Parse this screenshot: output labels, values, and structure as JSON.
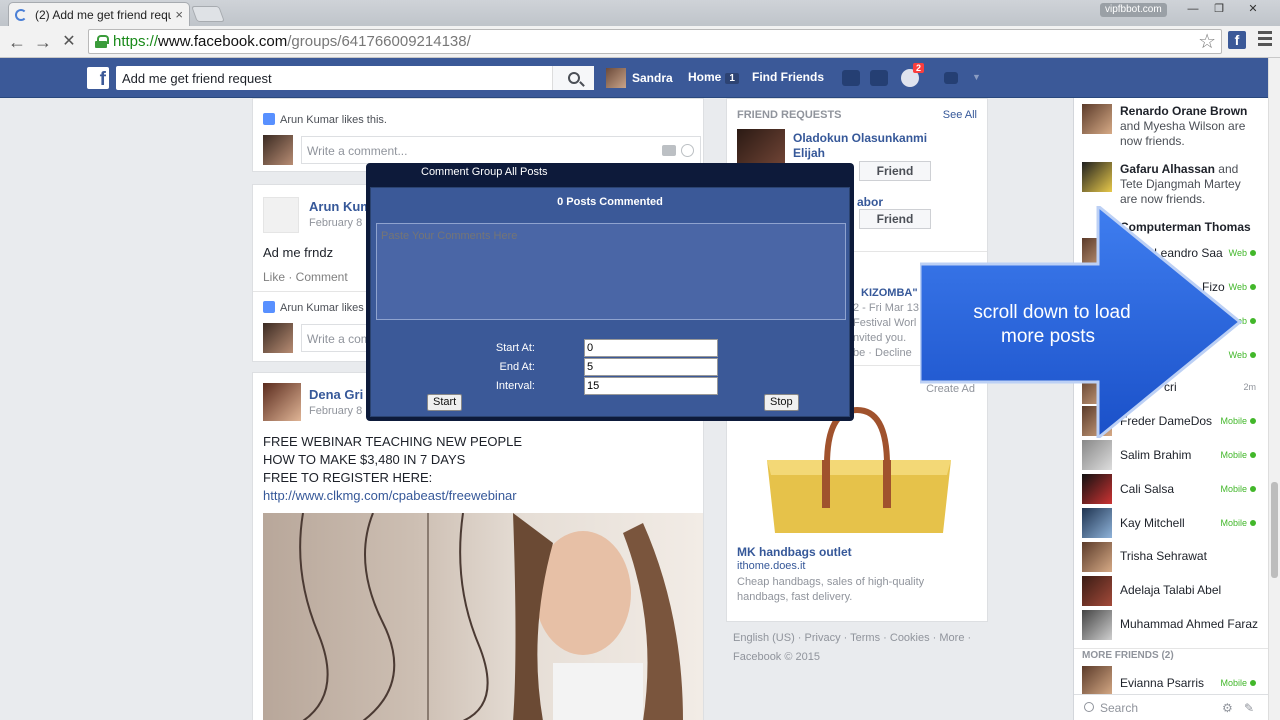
{
  "browser": {
    "tab_title": "(2) Add me get friend requ",
    "tab_close": "×",
    "window_label": "vipfbbot.com",
    "url_scheme": "https://",
    "url_host": "www.facebook.com",
    "url_path": "/groups/641766009214138/",
    "controls": {
      "minimize": "—",
      "maximize": "❐",
      "close": "✕"
    }
  },
  "fb_header": {
    "logo": "f",
    "search_value": "Add me get friend request",
    "user_name": "Sandra",
    "home_label": "Home",
    "home_count": "1",
    "find_friends_label": "Find Friends",
    "notifications_count": "2"
  },
  "feed": {
    "like_line": "Arun Kumar likes this.",
    "comment_placeholder": "Write a comment...",
    "post1": {
      "author": "Arun Kum",
      "date": "February 8",
      "text": "Ad me frndz",
      "actions": "Like · Comment",
      "like_line": "Arun Kumar likes",
      "comment_placeholder": "Write a comm"
    },
    "post2": {
      "author": "Dena Gri",
      "date": "February 8",
      "lines": [
        "FREE WEBINAR TEACHING NEW PEOPLE",
        "HOW TO MAKE $3,480 IN 7 DAYS",
        "FREE TO REGISTER HERE:"
      ],
      "link": "http://www.clkmg.com/cpabeast/freewebinar"
    }
  },
  "middle_col": {
    "friend_requests_title": "FRIEND REQUESTS",
    "see_all": "See All",
    "request1_name": "Oladokun Olasunkanmi Elijah",
    "add_friend": "Friend",
    "request2_name_tail": "abor",
    "event_title": "KIZOMBA\"",
    "event_date": "2 - Fri Mar 13",
    "event_place": "Festival Worl",
    "event_invited": "nvited you.",
    "event_actions": "be · Decline",
    "create_ad": "Create Ad",
    "ad_title": "MK handbags outlet",
    "ad_domain": "ithome.does.it",
    "ad_text": "Cheap handbags, sales of high-quality handbags, fast delivery.",
    "footer_links": "English (US) · Privacy · Terms · Cookies · More ·",
    "footer_copy": "Facebook © 2015"
  },
  "extension_dialog": {
    "title": "Comment Group All Posts",
    "posts_commented": "0 Posts Commented",
    "textarea_placeholder": "Paste Your Comments Here",
    "start_label": "Start At:",
    "start_value": "0",
    "end_label": "End At:",
    "end_value": "5",
    "interval_label": "Interval:",
    "interval_value": "15",
    "start_button": "Start",
    "stop_button": "Stop"
  },
  "arrow_callout": {
    "line1": "scroll down to load",
    "line2": "more posts",
    "color": "#1a57d8"
  },
  "chat": {
    "ticker": [
      {
        "name": "Renardo Orane Brown",
        "rest": "and Myesha Wilson are now friends."
      },
      {
        "name": "Gafaru Alhassan",
        "rest": "and Tete Djangmah Martey are now friends."
      },
      {
        "name": "Computerman Thomas",
        "rest": ""
      }
    ],
    "contacts": [
      {
        "name": "Leandro Saa",
        "status": "Web"
      },
      {
        "name": "Fizo",
        "status": "Web"
      },
      {
        "name": "",
        "status": "Web"
      },
      {
        "name": "",
        "status": "Web"
      },
      {
        "name": "cri",
        "status": "2m"
      },
      {
        "name": "Freder DameDos",
        "status": "Mobile"
      },
      {
        "name": "Salim Brahim",
        "status": "Mobile"
      },
      {
        "name": "Cali Salsa",
        "status": "Mobile"
      },
      {
        "name": "Kay Mitchell",
        "status": "Mobile"
      },
      {
        "name": "Trisha Sehrawat",
        "status": ""
      },
      {
        "name": "Adelaja Talabi Abel",
        "status": ""
      },
      {
        "name": "Muhammad Ahmed Faraz",
        "status": ""
      }
    ],
    "more_friends": "MORE FRIENDS (2)",
    "more_contact": {
      "name": "Evianna Psarris",
      "status": "Mobile"
    },
    "search_placeholder": "Search"
  }
}
